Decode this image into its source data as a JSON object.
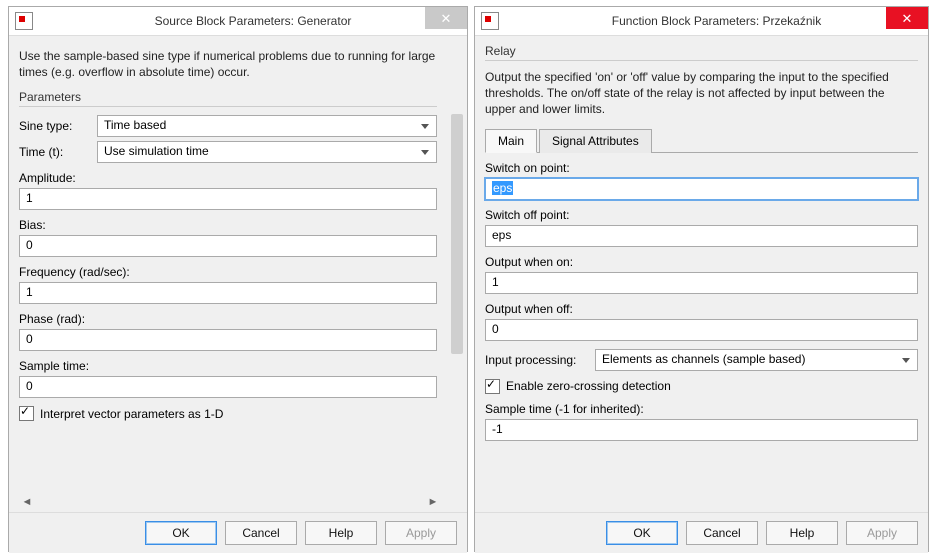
{
  "left": {
    "title": "Source Block Parameters: Generator",
    "desc": "Use the sample-based sine type if numerical problems due to running for large times (e.g. overflow in absolute time) occur.",
    "parameters_legend": "Parameters",
    "sine_type_label": "Sine type:",
    "sine_type_value": "Time based",
    "time_label": "Time (t):",
    "time_value": "Use simulation time",
    "amplitude_label": "Amplitude:",
    "amplitude_value": "1",
    "bias_label": "Bias:",
    "bias_value": "0",
    "freq_label": "Frequency (rad/sec):",
    "freq_value": "1",
    "phase_label": "Phase (rad):",
    "phase_value": "0",
    "sample_label": "Sample time:",
    "sample_value": "0",
    "interpret_label": "Interpret vector parameters as 1-D",
    "buttons": {
      "ok": "OK",
      "cancel": "Cancel",
      "help": "Help",
      "apply": "Apply"
    }
  },
  "right": {
    "title": "Function Block Parameters: Przekaźnik",
    "relay_legend": "Relay",
    "desc": "Output the specified 'on' or 'off' value by comparing the input to the specified thresholds.  The on/off state of the relay is not affected by input between the upper and lower limits.",
    "tabs": {
      "main": "Main",
      "signal": "Signal Attributes"
    },
    "switch_on_label": "Switch on point:",
    "switch_on_value": "eps",
    "switch_off_label": "Switch off point:",
    "switch_off_value": "eps",
    "out_on_label": "Output when on:",
    "out_on_value": "1",
    "out_off_label": "Output when off:",
    "out_off_value": "0",
    "input_proc_label": "Input processing:",
    "input_proc_value": "Elements as channels (sample based)",
    "zero_cross_label": "Enable zero-crossing detection",
    "sample_time_label": "Sample time (-1 for inherited):",
    "sample_time_value": "-1",
    "buttons": {
      "ok": "OK",
      "cancel": "Cancel",
      "help": "Help",
      "apply": "Apply"
    }
  }
}
